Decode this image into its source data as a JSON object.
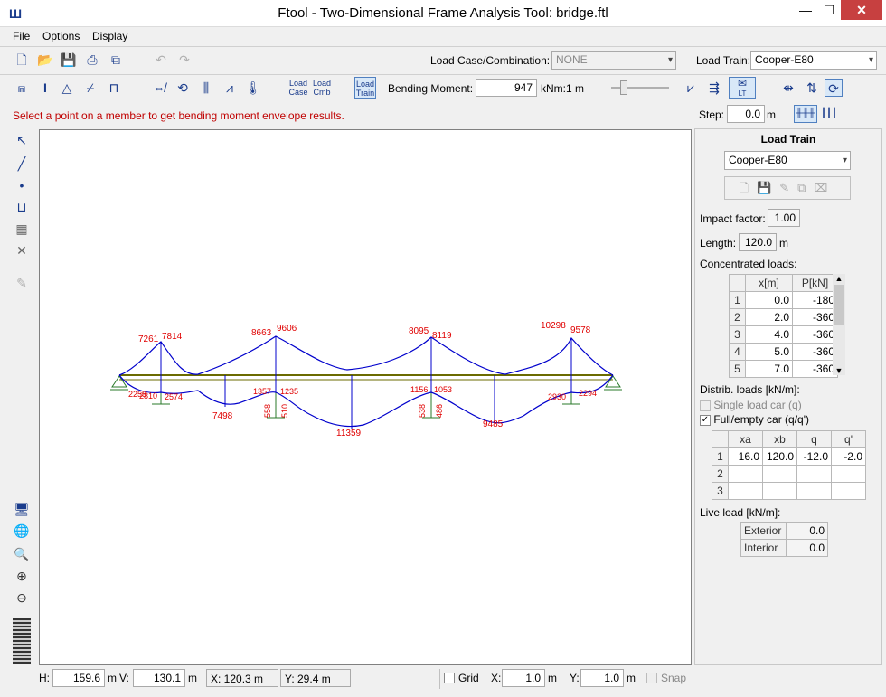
{
  "window": {
    "title": "Ftool - Two-Dimensional Frame Analysis Tool: bridge.ftl",
    "minimize": "—",
    "maximize": "☐",
    "close": "✕"
  },
  "menu": [
    "File",
    "Options",
    "Display"
  ],
  "toolbar1": {
    "load_case_label": "Load Case/Combination:",
    "load_case_value": "NONE",
    "load_train_label": "Load Train:",
    "load_train_value": "Cooper-E80"
  },
  "toolbar2": {
    "load_case_btn": [
      "Load",
      "Case"
    ],
    "load_cmb_btn": [
      "Load",
      "Cmb"
    ],
    "load_train_btn": [
      "Load",
      "Train"
    ],
    "bending_label": "Bending Moment:",
    "bending_value": "947",
    "scale_unit": "kNm:1 m",
    "lt_label": "LT"
  },
  "status_message": "Select a point on a member to get bending moment envelope results.",
  "step": {
    "label": "Step:",
    "value": "0.0",
    "unit": "m"
  },
  "panel": {
    "heading": "Load Train",
    "train_select": "Cooper-E80",
    "impact_label": "Impact factor:",
    "impact_value": "1.00",
    "length_label": "Length:",
    "length_value": "120.0",
    "length_unit": "m",
    "conc_label": "Concentrated loads:",
    "conc_headers": [
      "x[m]",
      "P[kN]"
    ],
    "conc_rows": [
      [
        "1",
        "0.0",
        "-180"
      ],
      [
        "2",
        "2.0",
        "-360"
      ],
      [
        "3",
        "4.0",
        "-360"
      ],
      [
        "4",
        "5.0",
        "-360"
      ],
      [
        "5",
        "7.0",
        "-360"
      ]
    ],
    "distrib_label": "Distrib. loads [kN/m]:",
    "single_car_label": "Single load car (q)",
    "full_car_label": "Full/empty car (q/q')",
    "distrib_headers": [
      "xa",
      "xb",
      "q",
      "q'"
    ],
    "distrib_rows": [
      [
        "1",
        "16.0",
        "120.0",
        "-12.0",
        "-2.0"
      ],
      [
        "2",
        "",
        "",
        "",
        ""
      ],
      [
        "3",
        "",
        "",
        "",
        ""
      ]
    ],
    "live_label": "Live load [kN/m]:",
    "exterior_label": "Exterior",
    "exterior_value": "0.0",
    "interior_label": "Interior",
    "interior_value": "0.0"
  },
  "bottom": {
    "h_label": "H:",
    "h_value": "159.6",
    "h_unit": "m",
    "v_label": "V:",
    "v_value": "130.1",
    "v_unit": "m",
    "x_readout": "X: 120.3 m",
    "y_readout": "Y: 29.4 m",
    "grid_label": "Grid",
    "gx_label": "X:",
    "gx_value": "1.0",
    "gx_unit": "m",
    "gy_label": "Y:",
    "gy_value": "1.0",
    "gy_unit": "m",
    "snap_label": "Snap"
  },
  "diagram_labels": {
    "top": [
      "7261",
      "7814",
      "8663",
      "9606",
      "8095",
      "8119",
      "10298",
      "9578"
    ],
    "bottom": [
      "7498",
      "11359",
      "9485"
    ],
    "small": [
      "2258",
      "2810",
      "2574",
      "1357",
      "1235",
      "1156",
      "1053",
      "2930",
      "2294",
      "558",
      "510",
      "538",
      "486"
    ]
  },
  "colors": {
    "accent": "#1a3c8c",
    "diagram": "#0000cc",
    "labels": "#e00000",
    "structure": "#6b6b00"
  }
}
